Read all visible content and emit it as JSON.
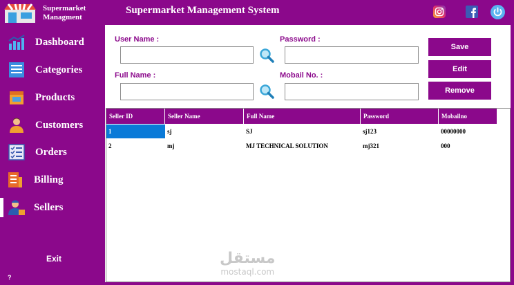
{
  "app": {
    "brand_line1": "Supermarket",
    "brand_line2": "Managment",
    "title": "Supermarket Management System"
  },
  "sidebar": {
    "items": [
      {
        "label": "Dashboard",
        "icon": "chart-icon"
      },
      {
        "label": "Categories",
        "icon": "list-icon"
      },
      {
        "label": "Products",
        "icon": "box-icon"
      },
      {
        "label": "Customers",
        "icon": "user-icon"
      },
      {
        "label": "Orders",
        "icon": "checklist-icon"
      },
      {
        "label": "Billing",
        "icon": "receipt-icon"
      },
      {
        "label": "Sellers",
        "icon": "seller-icon"
      }
    ],
    "active": "Sellers",
    "exit_label": "Exit",
    "help_label": "?"
  },
  "header_icons": [
    "instagram-icon",
    "facebook-icon",
    "power-icon"
  ],
  "form": {
    "user_name_label": "User Name :",
    "user_name_value": "",
    "password_label": "Password :",
    "password_value": "",
    "full_name_label": "Full Name :",
    "full_name_value": "",
    "mobile_label": "Mobail No. :",
    "mobile_value": ""
  },
  "buttons": {
    "save": "Save",
    "edit": "Edit",
    "remove": "Remove"
  },
  "table": {
    "columns": [
      "Seller ID",
      "Seller Name",
      "Full Name",
      "Password",
      "Mobailno"
    ],
    "rows": [
      [
        "1",
        "sj",
        "SJ",
        "sj123",
        "00000000"
      ],
      [
        "2",
        "mj",
        "MJ TECHNICAL SOLUTION",
        "mj321",
        "000"
      ]
    ],
    "selected_cell": [
      0,
      0
    ]
  },
  "watermark": {
    "arabic": "مستقل",
    "latin": "mostaql.com"
  },
  "colors": {
    "accent": "#8b088b",
    "selection": "#0a7ad8"
  }
}
